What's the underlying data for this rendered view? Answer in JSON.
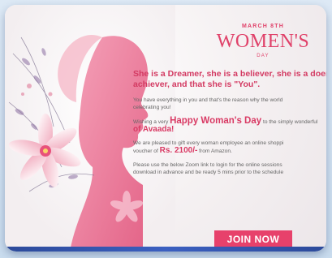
{
  "header": {
    "date": "MARCH 8TH",
    "title": "WOMEN'S",
    "day": "DAY"
  },
  "quote": {
    "line1": "She is a Dreamer, she is a believer, she is a doer, she",
    "line2": "achiever, and that she is \"You\"."
  },
  "para1": {
    "line1": "You have everything in you and that's the reason why the world",
    "line2": "celebrating you!"
  },
  "para2": {
    "pre": "Wishing a very ",
    "highlight": "Happy Woman's Day",
    "post": " to the simply wonderful",
    "company": "of Avaada!"
  },
  "para3": {
    "line1": "We are pleased to gift every woman employee an online shoppi",
    "pre2": "voucher of ",
    "amount": "Rs. 2100/-",
    "post2": " from Amazon."
  },
  "para4": {
    "line1": "Please use the below Zoom link to login for the online sessions",
    "line2": "download in advance and be ready 5 mins prior to the schedule"
  },
  "cta": {
    "label": "JOIN NOW"
  },
  "colors": {
    "accent": "#e0426a",
    "border": "#2c4a9a"
  }
}
